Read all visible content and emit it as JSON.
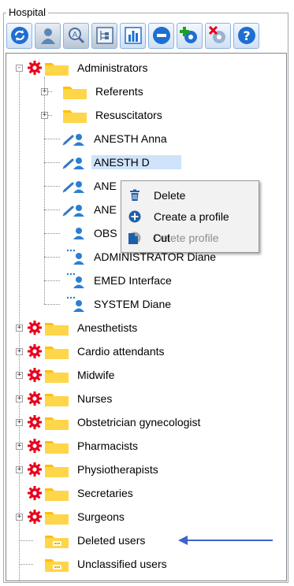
{
  "group": {
    "title": "Hospital"
  },
  "toolbar": {
    "buttons": [
      {
        "name": "refresh",
        "icon": "refresh-icon"
      },
      {
        "name": "user",
        "icon": "user-icon"
      },
      {
        "name": "search",
        "icon": "search-icon"
      },
      {
        "name": "tree-view",
        "icon": "tree-view-icon"
      },
      {
        "name": "chart",
        "icon": "bar-chart-icon"
      },
      {
        "name": "remove",
        "icon": "minus-circle-icon"
      },
      {
        "name": "add-settings",
        "icon": "gear-plus-icon"
      },
      {
        "name": "remove-settings",
        "icon": "gear-x-icon"
      },
      {
        "name": "help",
        "icon": "help-icon"
      }
    ]
  },
  "tree": {
    "root": {
      "label": "Administrators"
    },
    "children": [
      {
        "label": "Referents",
        "type": "folder"
      },
      {
        "label": "Resuscitators",
        "type": "folder"
      },
      {
        "label": "ANESTH Anna",
        "type": "anesth-user"
      },
      {
        "label": "ANESTH D",
        "type": "anesth-user"
      },
      {
        "label": "ANE",
        "type": "anesth-user"
      },
      {
        "label": "ANE",
        "type": "anesth-user"
      },
      {
        "label": "OBS",
        "type": "user"
      },
      {
        "label": "ADMINISTRATOR Diane",
        "type": "admin-user"
      },
      {
        "label": "EMED Interface",
        "type": "admin-user"
      },
      {
        "label": "SYSTEM Diane",
        "type": "admin-user"
      }
    ],
    "groups": [
      {
        "label": "Anesthetists",
        "expandable": true
      },
      {
        "label": "Cardio attendants",
        "expandable": true
      },
      {
        "label": "Midwife",
        "expandable": true
      },
      {
        "label": "Nurses",
        "expandable": true
      },
      {
        "label": "Obstetrician gynecologist",
        "expandable": true
      },
      {
        "label": "Pharmacists",
        "expandable": true
      },
      {
        "label": "Physiotherapists",
        "expandable": true
      },
      {
        "label": "Secretaries",
        "expandable": false
      },
      {
        "label": "Surgeons",
        "expandable": true
      }
    ],
    "special": [
      {
        "label": "Deleted users"
      },
      {
        "label": "Unclassified users"
      }
    ]
  },
  "context_menu": {
    "items": [
      {
        "label": "Delete",
        "icon": "trash-icon",
        "enabled": true
      },
      {
        "label": "Create a profile",
        "icon": "plus-circle-icon",
        "enabled": true
      },
      {
        "label": "Delete profile",
        "icon": "minus-circle-icon",
        "enabled": false
      },
      {
        "label": "Cut",
        "icon": "cut-icon",
        "enabled": true
      }
    ]
  },
  "colors": {
    "folder": "#ffc000",
    "gear": "#e8001c",
    "selection": "#cfe3fb",
    "arrow": "#3d64c8",
    "toolbar_blue": "#1e6fd0"
  }
}
